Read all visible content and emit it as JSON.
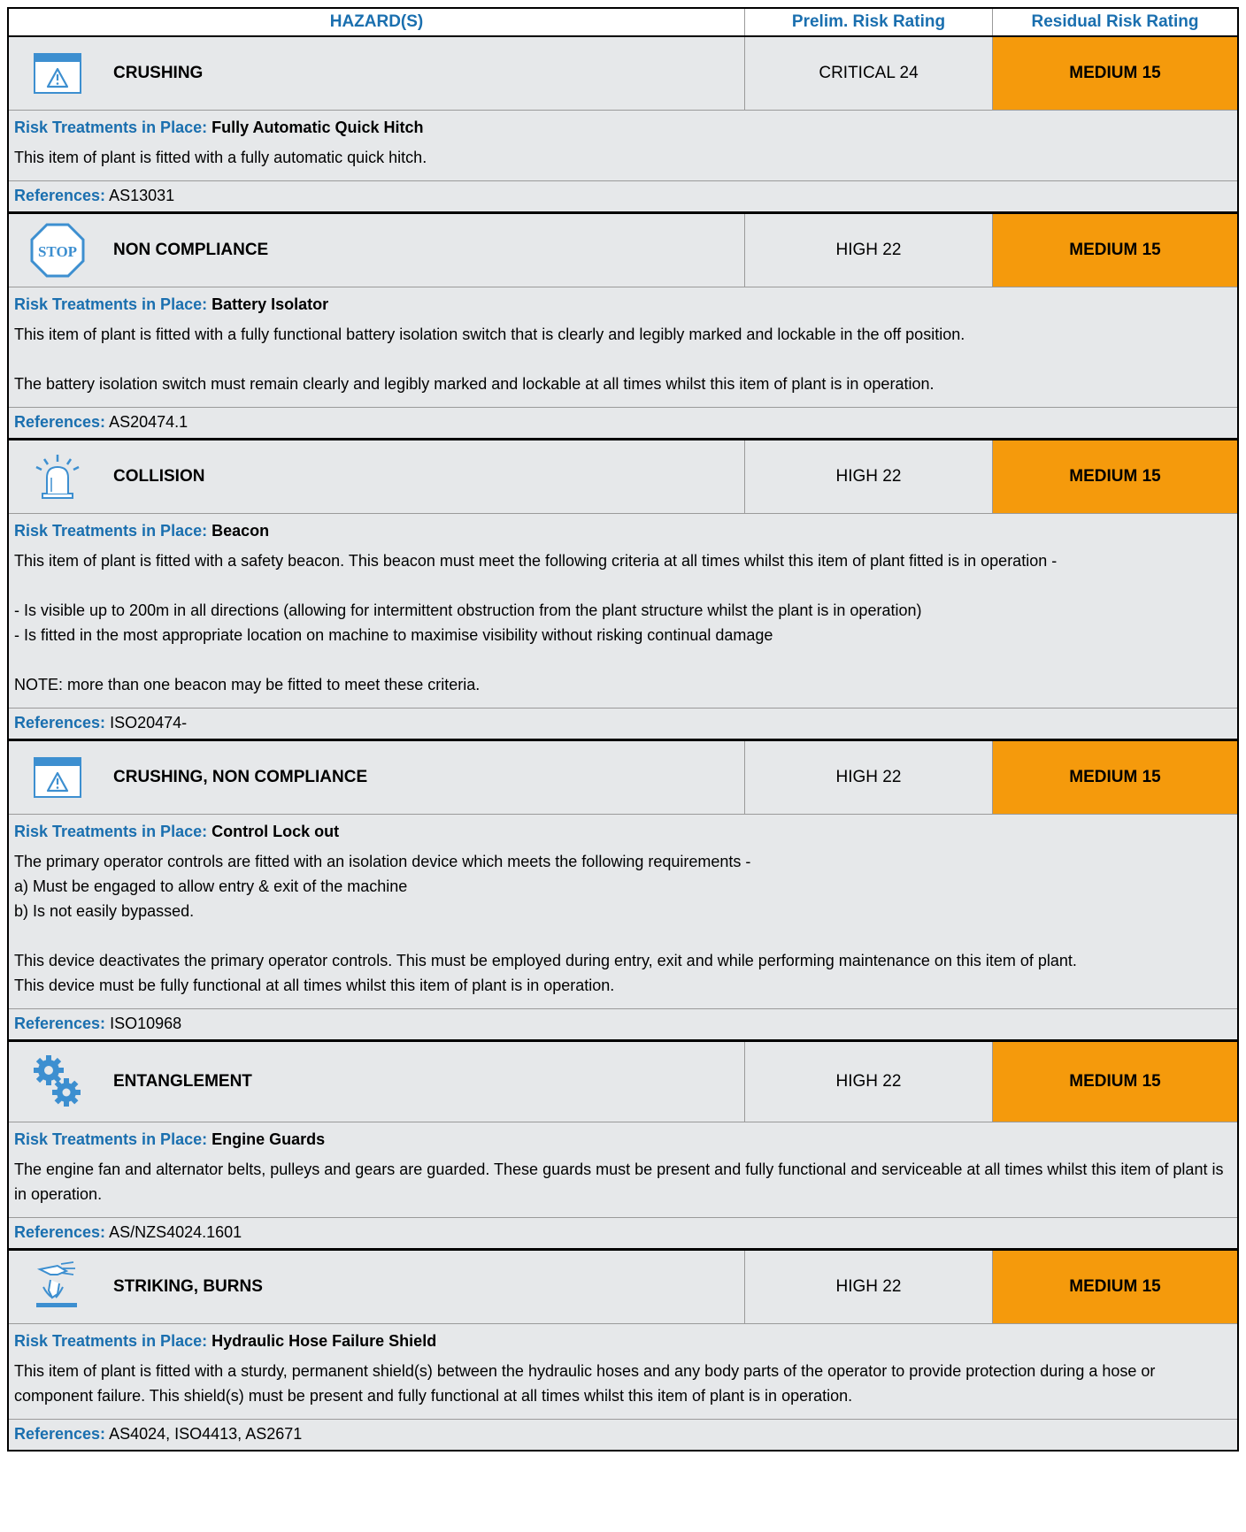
{
  "header": {
    "hazards": "HAZARD(S)",
    "prelim": "Prelim. Risk Rating",
    "residual": "Residual Risk Rating"
  },
  "labels": {
    "treatments": "Risk Treatments in Place:",
    "references": "References:"
  },
  "colors": {
    "accent": "#1a6faf",
    "residual_bg": "#f59a0c",
    "row_bg": "#e6e8ea"
  },
  "hazards": [
    {
      "icon": "warning-window-icon",
      "name": "CRUSHING",
      "prelim": "CRITICAL 24",
      "residual": "MEDIUM 15",
      "treatment": "Fully Automatic Quick Hitch",
      "body": [
        "This item of plant is fitted with a fully automatic quick hitch."
      ],
      "references": "AS13031"
    },
    {
      "icon": "stop-sign-icon",
      "icon_text": "STOP",
      "name": "NON COMPLIANCE",
      "prelim": "HIGH 22",
      "residual": "MEDIUM 15",
      "treatment": "Battery Isolator",
      "body": [
        "This item of plant is fitted with a fully functional battery isolation switch that is clearly and legibly marked and lockable in the off position.",
        "",
        "The battery isolation switch must remain clearly and legibly marked and lockable at all times whilst this item of plant is in operation."
      ],
      "references": "AS20474.1"
    },
    {
      "icon": "beacon-light-icon",
      "name": "COLLISION",
      "prelim": "HIGH 22",
      "residual": "MEDIUM 15",
      "treatment": "Beacon",
      "body": [
        "This item of plant is fitted with a safety beacon. This beacon must meet the following criteria at all times whilst this item of plant fitted is in operation -",
        "",
        "- Is visible up to 200m in all directions (allowing for intermittent obstruction from the plant structure whilst the plant is in operation)",
        "- Is fitted in the most appropriate location on machine to maximise visibility without risking continual damage",
        "",
        "NOTE: more than one beacon may be fitted to meet these criteria."
      ],
      "references": "ISO20474-"
    },
    {
      "icon": "warning-window-icon",
      "name": "CRUSHING, NON COMPLIANCE",
      "prelim": "HIGH 22",
      "residual": "MEDIUM 15",
      "treatment": "Control Lock out",
      "body": [
        "The primary operator controls are fitted with an isolation device which meets the following requirements -",
        "a) Must be engaged to allow entry & exit of the machine",
        "b) Is not easily bypassed.",
        "",
        "This device deactivates the primary operator controls. This must be employed during entry, exit and while performing maintenance on this item of plant.",
        "This device must be fully functional at all times whilst this item of plant is in operation."
      ],
      "references": "ISO10968"
    },
    {
      "icon": "gears-icon",
      "name": "ENTANGLEMENT",
      "prelim": "HIGH 22",
      "residual": "MEDIUM 15",
      "treatment": "Engine Guards",
      "body": [
        "The engine fan and alternator belts, pulleys and gears are guarded. These guards must be present and fully functional and serviceable at all times whilst this item of plant is in operation."
      ],
      "references": "AS/NZS4024.1601"
    },
    {
      "icon": "hand-spray-icon",
      "name": "STRIKING, BURNS",
      "prelim": "HIGH 22",
      "residual": "MEDIUM 15",
      "treatment": "Hydraulic Hose Failure Shield",
      "body": [
        "This item of plant is fitted with a sturdy, permanent shield(s) between the hydraulic hoses and any body parts of the operator to provide protection during a hose or component failure. This shield(s) must be present and fully functional at all times whilst this item of plant is in operation."
      ],
      "references": "AS4024, ISO4413, AS2671"
    }
  ]
}
